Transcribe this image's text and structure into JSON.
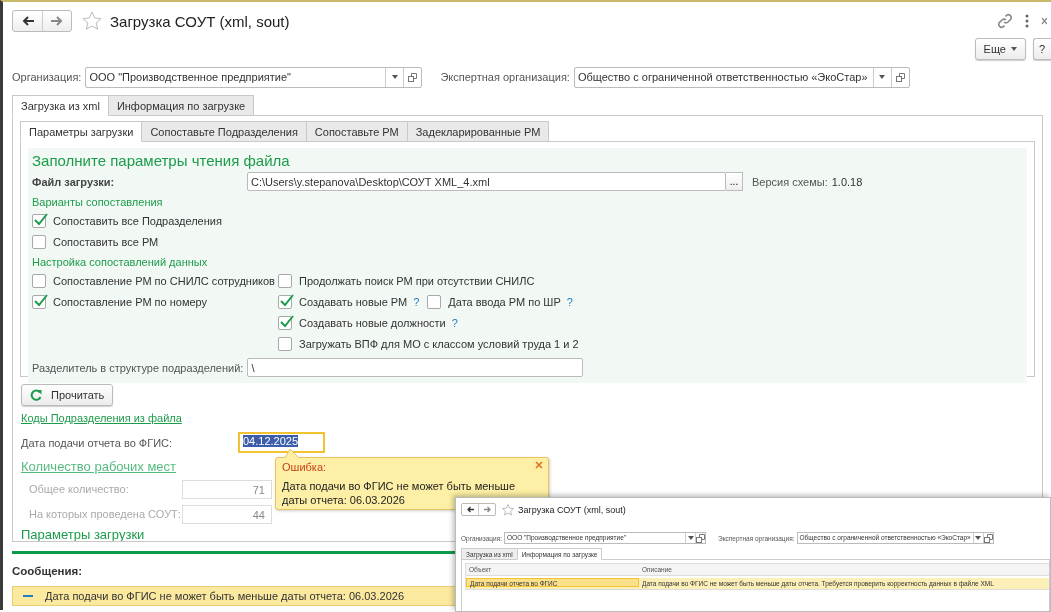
{
  "window": {
    "title": "Загрузка СОУТ (xml, sout)",
    "favorite": false
  },
  "command_bar": {
    "more_button": "Еще",
    "help_button": "?"
  },
  "organization": {
    "label": "Организация:",
    "value": "ООО \"Производственное предприятие\""
  },
  "expert_organization": {
    "label": "Экспертная организация:",
    "value": "Общество с ограниченной ответственностью «ЭкоСтар»"
  },
  "tabs": [
    {
      "label": "Загрузка из xml",
      "selected": true
    },
    {
      "label": "Информация по загрузке",
      "selected": false
    }
  ],
  "subtabs": [
    {
      "label": "Параметры загрузки",
      "selected": true
    },
    {
      "label": "Сопоставьте Подразделения",
      "selected": false
    },
    {
      "label": "Сопоставьте РМ",
      "selected": false
    },
    {
      "label": "Задекларированные РМ",
      "selected": false
    }
  ],
  "params": {
    "heading": "Заполните параметры чтения файла",
    "file_label": "Файл загрузки:",
    "file_value": "C:\\Users\\y.stepanova\\Desktop\\СОУТ XML_4.xml",
    "browse_button": "...",
    "schema_label": "Версия схемы:",
    "schema_value": "1.0.18",
    "match_options": {
      "title": "Варианты сопоставления",
      "items": [
        {
          "label": "Сопоставить все Подразделения",
          "checked": true
        },
        {
          "label": "Сопоставить все РМ",
          "checked": false
        }
      ]
    },
    "data_settings": {
      "title": "Настройка сопоставлений данных",
      "left": [
        {
          "label": "Сопоставление РМ по СНИЛС сотрудников",
          "checked": false
        },
        {
          "label": "Сопоставление РМ по номеру",
          "checked": true
        }
      ],
      "right": [
        [
          {
            "label": "Продолжать поиск РМ при отсутствии СНИЛС",
            "checked": false
          }
        ],
        [
          {
            "label": "Создавать новые РМ",
            "checked": true,
            "help": "?"
          },
          {
            "label": "Дата ввода РМ по ШР",
            "checked": false,
            "help": "?"
          }
        ],
        [
          {
            "label": "Создавать новые должности",
            "checked": true,
            "help": "?"
          }
        ],
        [
          {
            "label": "Загружать ВПФ для МО с классом условий труда 1 и 2",
            "checked": false
          }
        ]
      ]
    },
    "separator_label": "Разделитель в структуре подразделений:",
    "separator_value": "\\"
  },
  "read_button": "Прочитать",
  "codes_link": "Коды Подразделения из файла",
  "report_date": {
    "label": "Дата подачи отчета во ФГИС:",
    "value": "04.12.2025",
    "error": true
  },
  "workplaces": {
    "title": "Количество рабочих мест",
    "rows": [
      {
        "label": "Общее количество:",
        "value": "71"
      },
      {
        "label": "На которых проведена СОУТ:",
        "value": "44"
      }
    ]
  },
  "load_params_title": "Параметры загрузки",
  "error_tooltip": {
    "title": "Ошибка:",
    "text": "Дата подачи во ФГИС не может быть меньше даты отчета: 06.03.2026"
  },
  "messages": {
    "title": "Сообщения:",
    "items": [
      {
        "text": "Дата подачи во ФГИС не может быть меньше даты отчета: 06.03.2026"
      }
    ]
  },
  "inset_window": {
    "title": "Загрузка СОУТ (xml, sout)",
    "organization": {
      "label": "Организация:",
      "value": "ООО \"Производственное предприятие\""
    },
    "expert_organization": {
      "label": "Экспертная организация:",
      "value": "Общество с ограниченной ответственностью «ЭкоСтар»"
    },
    "tabs": [
      {
        "label": "Загрузка из xml",
        "selected": false
      },
      {
        "label": "Информация по загрузке",
        "selected": true
      }
    ],
    "columns": [
      "Объект",
      "Описание"
    ],
    "rows": [
      {
        "cells": [
          "Дата подачи отчета во ФГИС",
          "Дата подачи во ФГИС не может быть меньше даты отчета. Требуется проверить корректность данных в файле XML"
        ],
        "selected": true
      }
    ]
  }
}
